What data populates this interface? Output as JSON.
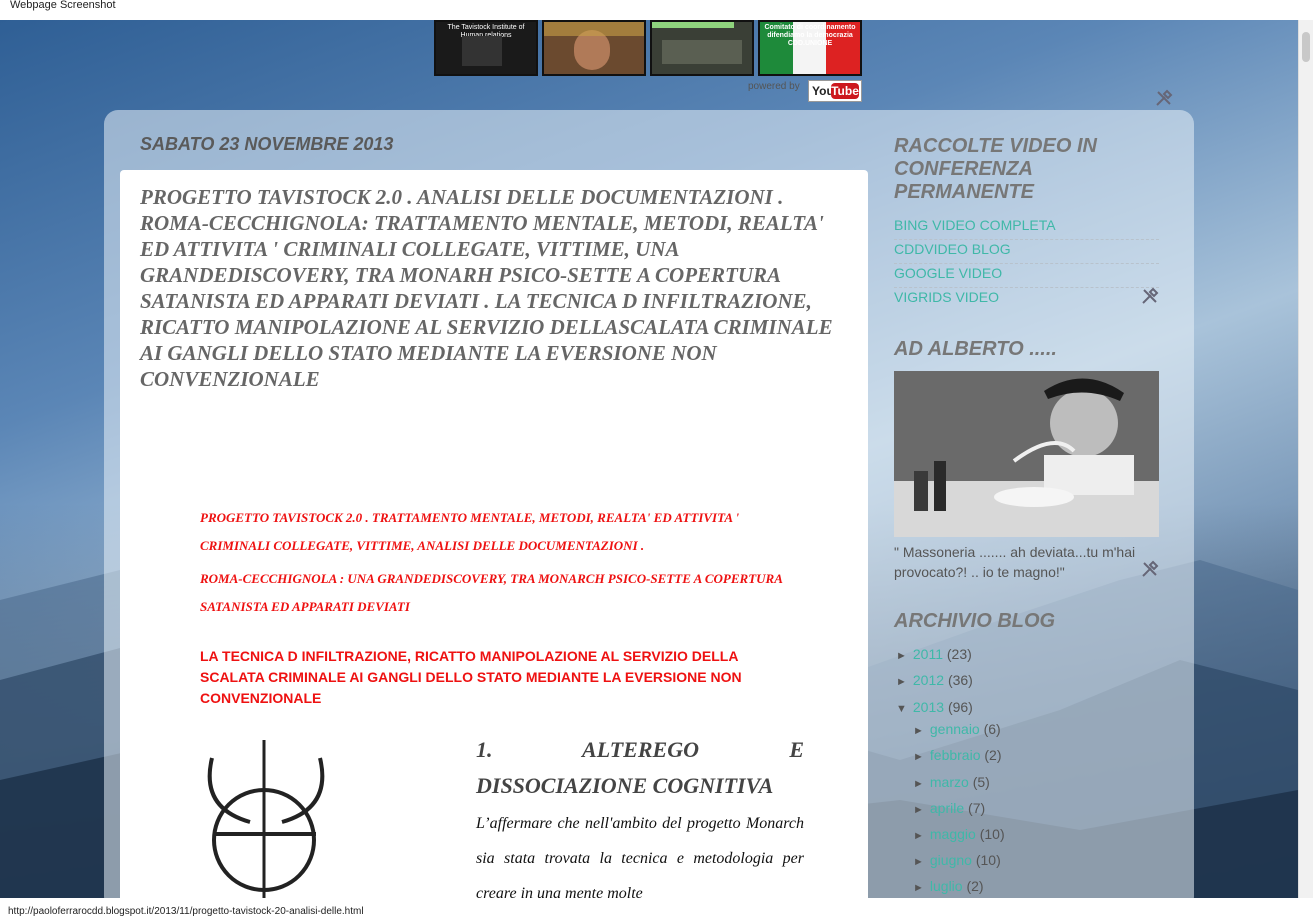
{
  "window": {
    "title": "Webpage Screenshot"
  },
  "status_bar": {
    "url": "http://paoloferrarocdd.blogspot.it/2013/11/progetto-tavistock-20-analisi-delle.html"
  },
  "video_strip": {
    "thumbs": [
      {
        "caption": "The Tavistock Institute of Human relations"
      },
      {
        "caption": ""
      },
      {
        "caption": ""
      },
      {
        "caption": "Comitato di coordinamento difendiamo la democrazia CDD.UNIONE"
      }
    ],
    "powered_by": "powered by",
    "youtube_you": "You",
    "youtube_tube": "Tube"
  },
  "post": {
    "date": "SABATO 23 NOVEMBRE 2013",
    "title": "PROGETTO TAVISTOCK 2.0 . ANALISI DELLE DOCUMENTAZIONI . ROMA-CECCHIGNOLA: TRATTAMENTO MENTALE, METODI, REALTA' ED ATTIVITA ' CRIMINALI COLLEGATE, VITTIME, UNA GRANDEDISCOVERY, TRA MONARH PSICO-SETTE A COPERTURA SATANISTA ED APPARATI DEVIATI . LA TECNICA D INFILTRAZIONE, RICATTO MANIPOLAZIONE AL SERVIZIO DELLASCALATA CRIMINALE AI GANGLI DELLO STATO MEDIANTE LA EVERSIONE NON CONVENZIONALE",
    "red_para_1": "PROGETTO TAVISTOCK 2.0 . TRATTAMENTO MENTALE,  METODI,  REALTA' ED ATTIVITA ' CRIMINALI COLLEGATE, VITTIME,  ANALISI DELLE DOCUMENTAZIONI .",
    "red_para_2": "ROMA-CECCHIGNOLA :  UNA GRANDEDISCOVERY, TRA  MONARCH PSICO-SETTE A COPERTURA SATANISTA ED APPARATI DEVIATI",
    "red_para_3": "LA TECNICA D INFILTRAZIONE, RICATTO MANIPOLAZIONE AL SERVIZIO DELLA SCALATA CRIMINALE AI GANGLI DELLO STATO MEDIANTE LA EVERSIONE NON CONVENZIONALE",
    "section_title_line1": "1.        ALTEREGO        E",
    "section_title_line2": "DISSOCIAZIONE COGNITIVA",
    "section_body": "L’affermare che nell'ambito del progetto Monarch sia stata trovata la tecnica e metodologia per creare in una mente molte"
  },
  "sidebar": {
    "raccolte_heading": "RACCOLTE VIDEO IN CONFERENZA PERMANENTE",
    "links": [
      "BING VIDEO COMPLETA",
      "CDDVIDEO BLOG",
      "GOOGLE VIDEO",
      "VIGRIDS VIDEO"
    ],
    "alberto_heading": "AD ALBERTO .....",
    "alberto_caption": "\" Massoneria ....... ah deviata...tu m'hai provocato?! .. io te magno!\"",
    "archive_heading": "ARCHIVIO BLOG",
    "archive": [
      {
        "label": "2011",
        "count": "(23)",
        "expanded": false,
        "level": 0
      },
      {
        "label": "2012",
        "count": "(36)",
        "expanded": false,
        "level": 0
      },
      {
        "label": "2013",
        "count": "(96)",
        "expanded": true,
        "level": 0
      },
      {
        "label": "gennaio",
        "count": "(6)",
        "expanded": false,
        "level": 1
      },
      {
        "label": "febbraio",
        "count": "(2)",
        "expanded": false,
        "level": 1
      },
      {
        "label": "marzo",
        "count": "(5)",
        "expanded": false,
        "level": 1
      },
      {
        "label": "aprile",
        "count": "(7)",
        "expanded": false,
        "level": 1
      },
      {
        "label": "maggio",
        "count": "(10)",
        "expanded": false,
        "level": 1
      },
      {
        "label": "giugno",
        "count": "(10)",
        "expanded": false,
        "level": 1
      },
      {
        "label": "luglio",
        "count": "(2)",
        "expanded": false,
        "level": 1
      }
    ]
  },
  "colors": {
    "link": "#3fb8a8",
    "red_text": "#ee1111",
    "heading_gray": "#777777"
  }
}
